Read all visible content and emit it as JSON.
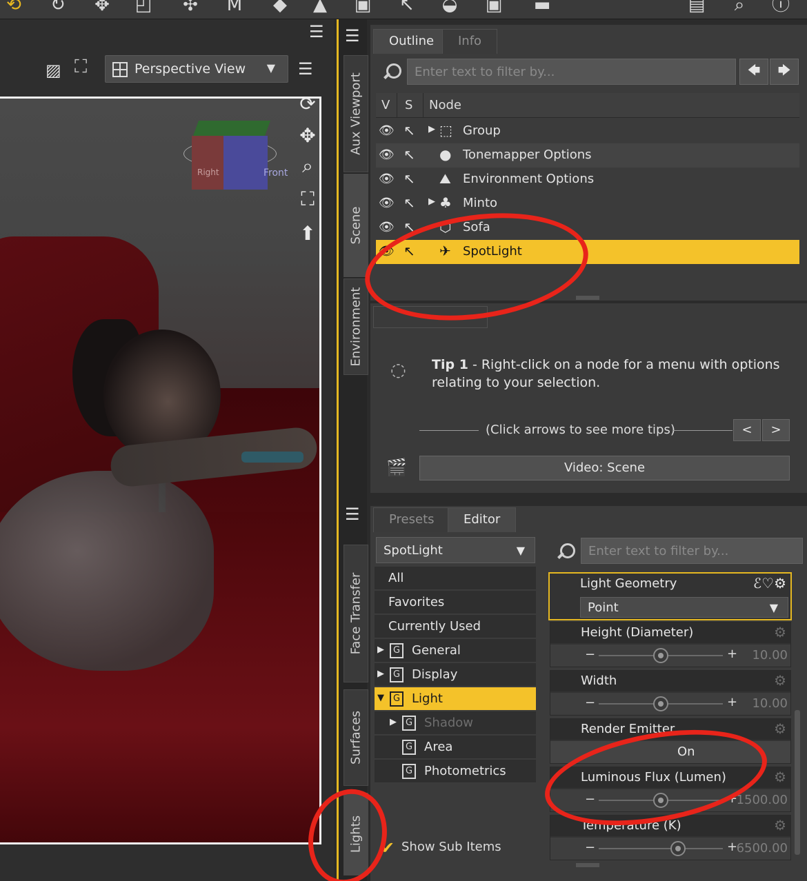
{
  "viewport": {
    "view_label": "Perspective View",
    "cube_left": "Right",
    "cube_front": "Front"
  },
  "side_tabs": {
    "aux_viewport": "Aux Viewport",
    "scene": "Scene",
    "environment": "Environment",
    "face_transfer": "Face Transfer",
    "surfaces": "Surfaces",
    "lights": "Lights"
  },
  "scene_pane": {
    "tabs": [
      "Outline",
      "Info"
    ],
    "filter_placeholder": "Enter text to filter by...",
    "columns": {
      "v": "V",
      "s": "S",
      "node": "Node"
    },
    "nodes": [
      {
        "label": "Group",
        "icon": "group-icon",
        "expandable": true,
        "selected": false
      },
      {
        "label": "Tonemapper Options",
        "icon": "tonemapper-icon",
        "expandable": false,
        "selected": false
      },
      {
        "label": "Environment Options",
        "icon": "environment-icon",
        "expandable": false,
        "selected": false
      },
      {
        "label": "Minto",
        "icon": "figure-icon",
        "expandable": true,
        "selected": false
      },
      {
        "label": "Sofa",
        "icon": "prop-icon",
        "expandable": false,
        "selected": false
      },
      {
        "label": "SpotLight",
        "icon": "spotlight-icon",
        "expandable": false,
        "selected": true
      }
    ]
  },
  "tips_pane": {
    "tip_title": "Tip 1",
    "tip_text": " - Right-click on a node for a menu with options relating to your selection.",
    "hint": "(Click arrows to see more tips)",
    "prev": "<",
    "next": ">",
    "video_button": "Video: Scene"
  },
  "lights_pane": {
    "tabs": [
      "Presets",
      "Editor"
    ],
    "selected_light": "SpotLight",
    "filter_placeholder": "Enter text to filter by...",
    "categories": [
      {
        "label": "All",
        "group": false,
        "expand": "",
        "active": false,
        "dim": false,
        "indent": 0
      },
      {
        "label": "Favorites",
        "group": false,
        "expand": "",
        "active": false,
        "dim": false,
        "indent": 0
      },
      {
        "label": "Currently Used",
        "group": false,
        "expand": "",
        "active": false,
        "dim": false,
        "indent": 0
      },
      {
        "label": "General",
        "group": true,
        "expand": "▶",
        "active": false,
        "dim": false,
        "indent": 0
      },
      {
        "label": "Display",
        "group": true,
        "expand": "▶",
        "active": false,
        "dim": false,
        "indent": 0
      },
      {
        "label": "Light",
        "group": true,
        "expand": "▼",
        "active": true,
        "dim": false,
        "indent": 0
      },
      {
        "label": "Shadow",
        "group": true,
        "expand": "▶",
        "active": false,
        "dim": true,
        "indent": 1
      },
      {
        "label": "Area",
        "group": true,
        "expand": "",
        "active": false,
        "dim": false,
        "indent": 1
      },
      {
        "label": "Photometrics",
        "group": true,
        "expand": "",
        "active": false,
        "dim": false,
        "indent": 1
      }
    ],
    "show_sub_items": "Show Sub Items",
    "light_geometry": {
      "name": "Light Geometry",
      "value": "Point"
    },
    "params": [
      {
        "name": "Height (Diameter)",
        "value": "10.00",
        "position": 0.5
      },
      {
        "name": "Width",
        "value": "10.00",
        "position": 0.5
      },
      {
        "name": "Render Emitter",
        "value": "On",
        "position": null
      },
      {
        "name": "Luminous Flux (Lumen)",
        "value": "1500.00",
        "position": 0.5
      },
      {
        "name": "Temperature (K)",
        "value": "6500.00",
        "position": 0.64
      }
    ]
  },
  "annotation_color": "#e8241a",
  "accent_color": "#f4c22a"
}
